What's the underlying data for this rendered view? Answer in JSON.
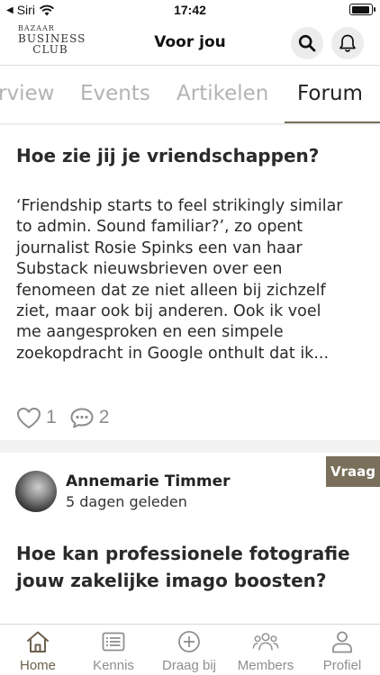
{
  "status_bar": {
    "back_label": "Siri",
    "time": "17:42",
    "battery_level": 0.95
  },
  "header": {
    "logo": {
      "top": "BAZAAR",
      "middle": "BUSINESS",
      "bottom": "CLUB"
    },
    "title": "Voor jou",
    "search_icon": "search-icon",
    "bell_icon": "bell-icon"
  },
  "tabs": [
    {
      "label": "rview",
      "active": false
    },
    {
      "label": "Events",
      "active": false
    },
    {
      "label": "Artikelen",
      "active": false
    },
    {
      "label": "Forum",
      "active": true
    }
  ],
  "posts": [
    {
      "title": "Hoe zie jij je vriendschappen?",
      "body_lines": [
        "‘Friendship starts to feel strikingly similar",
        "to admin. Sound familiar?’, zo opent",
        "journalist Rosie Spinks een van haar",
        "Substack nieuwsbrieven over een",
        "fenomeen dat ze niet alleen bij zichzelf",
        "ziet, maar ook bij anderen. Ook ik voel",
        "me aangesproken en een simpele",
        "zoekopdracht in Google onthult dat ik..."
      ],
      "likes": "1",
      "comments": "2"
    },
    {
      "badge": "Vraag",
      "author": "Annemarie Timmer",
      "date": "5 dagen geleden",
      "title_lines": [
        "Hoe kan professionele fotografie",
        "jouw zakelijke imago boosten?"
      ]
    }
  ],
  "bottom_nav": [
    {
      "label": "Home",
      "icon": "home-icon",
      "active": true
    },
    {
      "label": "Kennis",
      "icon": "list-icon",
      "active": false
    },
    {
      "label": "Draag bij",
      "icon": "plus-circle-icon",
      "active": false
    },
    {
      "label": "Members",
      "icon": "members-icon",
      "active": false
    },
    {
      "label": "Profiel",
      "icon": "profile-icon",
      "active": false
    }
  ],
  "colors": {
    "accent": "#776c59",
    "badge": "#7a6f5b",
    "inactive": "#8f8f8f"
  }
}
